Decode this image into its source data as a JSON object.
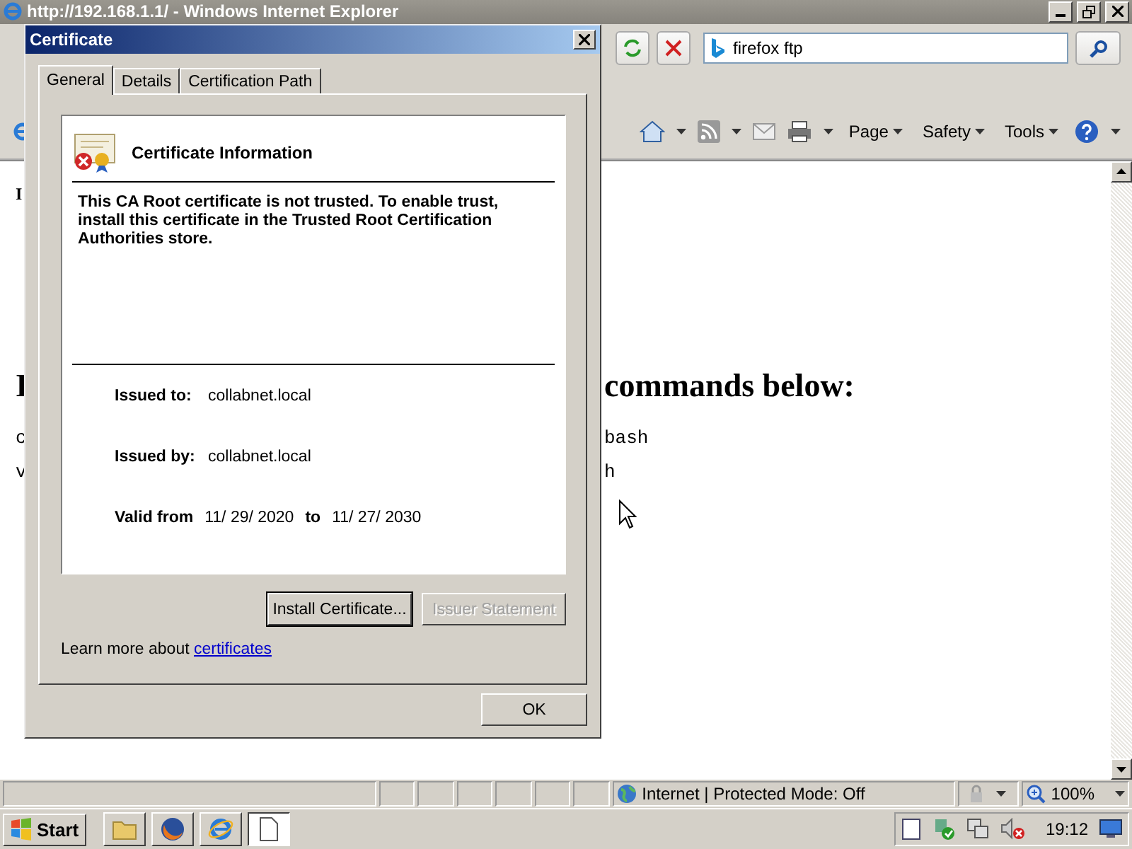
{
  "window": {
    "title": "http://192.168.1.1/ - Windows Internet Explorer"
  },
  "search": {
    "value": "firefox ftp"
  },
  "command_bar": {
    "menus": [
      "Page",
      "Safety",
      "Tools"
    ]
  },
  "page": {
    "rows": [
      {
        "kind": "small",
        "left": "I"
      },
      {
        "kind": "heading",
        "left": "I",
        "right": "commands below:"
      },
      {
        "kind": "code",
        "left": "c",
        "right": "bash"
      },
      {
        "kind": "code",
        "left": "v",
        "right": "h"
      }
    ]
  },
  "status_bar": {
    "zone": "Internet | Protected Mode: Off",
    "zoom": "100%"
  },
  "taskbar": {
    "start": "Start",
    "apps": [
      {
        "kind": "folder",
        "selected": false
      },
      {
        "kind": "firefox",
        "selected": false
      },
      {
        "kind": "ie",
        "selected": false
      },
      {
        "kind": "document",
        "selected": true
      }
    ],
    "clock": "19:12"
  },
  "dialog": {
    "title": "Certificate",
    "tabs": [
      {
        "label": "General",
        "selected": true
      },
      {
        "label": "Details",
        "selected": false
      },
      {
        "label": "Certification Path",
        "selected": false
      }
    ],
    "heading": "Certificate Information",
    "message": "This CA Root certificate is not trusted. To enable trust, install this certificate in the Trusted Root Certification Authorities store.",
    "fields": [
      {
        "label": "Issued to:",
        "value": "collabnet.local"
      },
      {
        "label": "Issued by:",
        "value": "collabnet.local"
      }
    ],
    "validity": {
      "label": "Valid from",
      "from": "11/ 29/ 2020",
      "to_label": "to",
      "to": "11/ 27/ 2030"
    },
    "buttons": [
      {
        "label": "Install Certificate...",
        "disabled": false,
        "focused": true
      },
      {
        "label": "Issuer Statement",
        "disabled": true,
        "focused": false
      }
    ],
    "learn_more": {
      "text": "Learn more about",
      "link": "certificates"
    },
    "ok": "OK"
  }
}
